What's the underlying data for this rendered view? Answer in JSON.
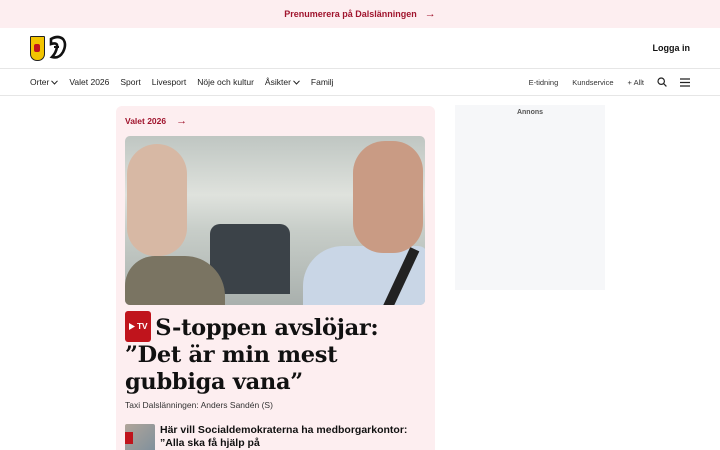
{
  "promo": {
    "text": "Prenumerera på Dalslänningen",
    "arrow": "→"
  },
  "header": {
    "logo_letters": "ꝺ",
    "login": "Logga in"
  },
  "nav": {
    "items": [
      "Orter",
      "Valet 2026",
      "Sport",
      "Livesport",
      "Nöje och kultur",
      "Åsikter",
      "Familj"
    ],
    "right": [
      "E-tidning",
      "Kundservice",
      "+ Allt"
    ]
  },
  "article": {
    "kicker": "Valet 2026",
    "tv_badge": "TV",
    "headline": "S-toppen avslöjar: ”Det är min mest gubbiga vana”",
    "byline": "Taxi Dalslänningen: Anders Sandén (S)"
  },
  "sub_article": {
    "headline": "Här vill Socialdemokraterna ha medborgarkontor: ”Alla ska få hjälp på"
  },
  "ad": {
    "label": "Annons"
  },
  "colors": {
    "accent": "#a0142d",
    "card_bg": "#fdeef0",
    "tv_red": "#c0141c"
  },
  "icons": [
    "arrow-right-icon",
    "search-icon",
    "menu-icon",
    "chevron-down-icon",
    "play-icon"
  ]
}
